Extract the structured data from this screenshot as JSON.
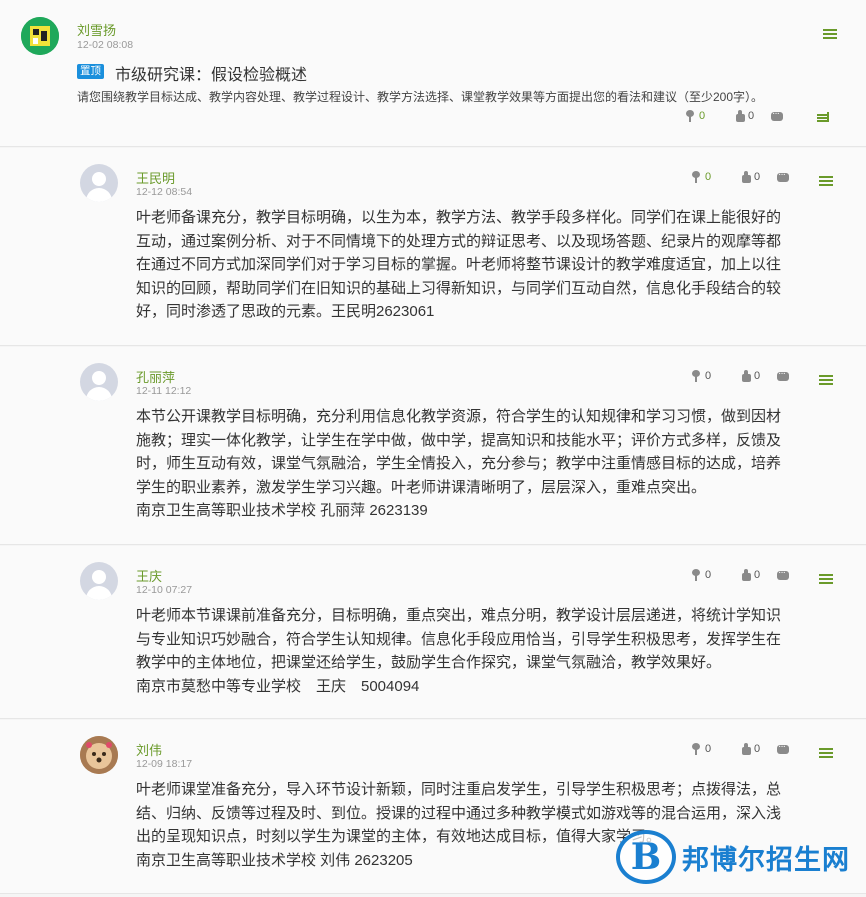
{
  "post": {
    "author": "刘雪扬",
    "date": "12-02 08:08",
    "badge": "置顶",
    "title": "市级研究课：假设检验概述",
    "description": "请您围绕教学目标达成、教学内容处理、教学过程设计、教学方法选择、课堂教学效果等方面提出您的看法和建议（至少200字）。",
    "flower_count": "0",
    "like_count": "0"
  },
  "replies": [
    {
      "author": "王民明",
      "date": "12-12 08:54",
      "flower_count": "0",
      "like_count": "0",
      "lines": [
        "叶老师备课充分，教学目标明确，以生为本，教学方法、教学手段多样化。同学们在课上能很好的",
        "互动，通过案例分析、对于不同情境下的处理方式的辩证思考、以及现场答题、纪录片的观摩等都",
        "在通过不同方式加深同学们对于学习目标的掌握。叶老师将整节课设计的教学难度适宜，加上以往",
        "知识的回顾，帮助同学们在旧知识的基础上习得新知识，与同学们互动自然，信息化手段结合的较",
        "好，同时渗透了思政的元素。王民明2623061"
      ]
    },
    {
      "author": "孔丽萍",
      "date": "12-11 12:12",
      "flower_count": "0",
      "like_count": "0",
      "lines": [
        "本节公开课教学目标明确，充分利用信息化教学资源，符合学生的认知规律和学习习惯，做到因材",
        "施教；理实一体化教学，让学生在学中做，做中学，提高知识和技能水平；评价方式多样，反馈及",
        "时，师生互动有效，课堂气氛融洽，学生全情投入，充分参与；教学中注重情感目标的达成，培养",
        "学生的职业素养，激发学生学习兴趣。叶老师讲课清晰明了，层层深入，重难点突出。",
        "南京卫生高等职业技术学校 孔丽萍 2623139"
      ]
    },
    {
      "author": "王庆",
      "date": "12-10 07:27",
      "flower_count": "0",
      "like_count": "0",
      "lines": [
        "叶老师本节课课前准备充分，目标明确，重点突出，难点分明，教学设计层层递进，将统计学知识",
        "与专业知识巧妙融合，符合学生认知规律。信息化手段应用恰当，引导学生积极思考，发挥学生在",
        "教学中的主体地位，把课堂还给学生，鼓励学生合作探究，课堂气氛融洽，教学效果好。",
        "南京市莫愁中等专业学校　王庆　5004094"
      ]
    },
    {
      "author": "刘伟",
      "date": "12-09 18:17",
      "flower_count": "0",
      "like_count": "0",
      "lines": [
        "叶老师课堂准备充分，导入环节设计新颖，同时注重启发学生，引导学生积极思考；点拨得法，总",
        "结、归纳、反馈等过程及时、到位。授课的过程中通过多种教学模式如游戏等的混合运用，深入浅",
        "出的呈现知识点，时刻以学生为课堂的主体，有效地达成目标，值得大家学习。",
        "南京卫生高等职业技术学校 刘伟 2623205"
      ]
    }
  ],
  "watermark": {
    "logo_letter": "B",
    "text": "邦博尔招生网"
  },
  "colors": {
    "accent_green": "#6a9a2a",
    "badge_blue": "#1a8fdc",
    "watermark_blue": "#1a7fd0"
  }
}
